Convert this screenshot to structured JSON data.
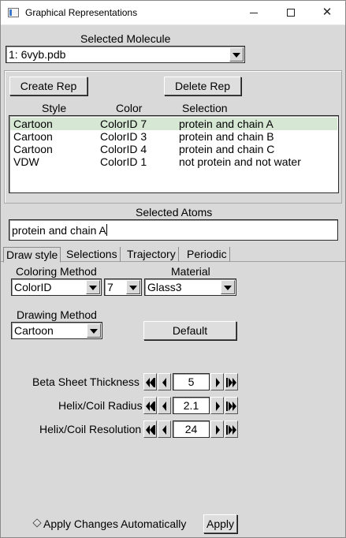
{
  "window": {
    "title": "Graphical Representations",
    "controls": {
      "minimize": "minimize-icon",
      "maximize": "maximize-icon",
      "close": "✕"
    }
  },
  "molecule": {
    "label": "Selected Molecule",
    "value": "1: 6vyb.pdb"
  },
  "reps": {
    "create_label": "Create Rep",
    "delete_label": "Delete Rep",
    "headers": {
      "style": "Style",
      "color": "Color",
      "selection": "Selection"
    },
    "rows": [
      {
        "style": "Cartoon",
        "color": "ColorID 7",
        "selection": "protein and chain A",
        "selected": true
      },
      {
        "style": "Cartoon",
        "color": "ColorID 3",
        "selection": "protein and chain B",
        "selected": false
      },
      {
        "style": "Cartoon",
        "color": "ColorID 4",
        "selection": "protein and chain C",
        "selected": false
      },
      {
        "style": "VDW",
        "color": "ColorID 1",
        "selection": "not protein and not water",
        "selected": false
      }
    ],
    "selected_row_color": "#d6e8d4"
  },
  "atoms": {
    "label": "Selected Atoms",
    "value": "protein and chain A"
  },
  "tabs": [
    {
      "label": "Draw style",
      "active": true
    },
    {
      "label": "Selections",
      "active": false
    },
    {
      "label": "Trajectory",
      "active": false
    },
    {
      "label": "Periodic",
      "active": false
    }
  ],
  "draw": {
    "coloring_label": "Coloring Method",
    "coloring_value": "ColorID",
    "color_id_value": "7",
    "material_label": "Material",
    "material_value": "Glass3",
    "drawing_label": "Drawing Method",
    "drawing_value": "Cartoon",
    "default_label": "Default"
  },
  "params": [
    {
      "label": "Beta Sheet Thickness",
      "value": "5"
    },
    {
      "label": "Helix/Coil Radius",
      "value": "2.1"
    },
    {
      "label": "Helix/Coil Resolution",
      "value": "24"
    }
  ],
  "footer": {
    "auto_label": "Apply Changes Automatically",
    "apply_label": "Apply"
  }
}
